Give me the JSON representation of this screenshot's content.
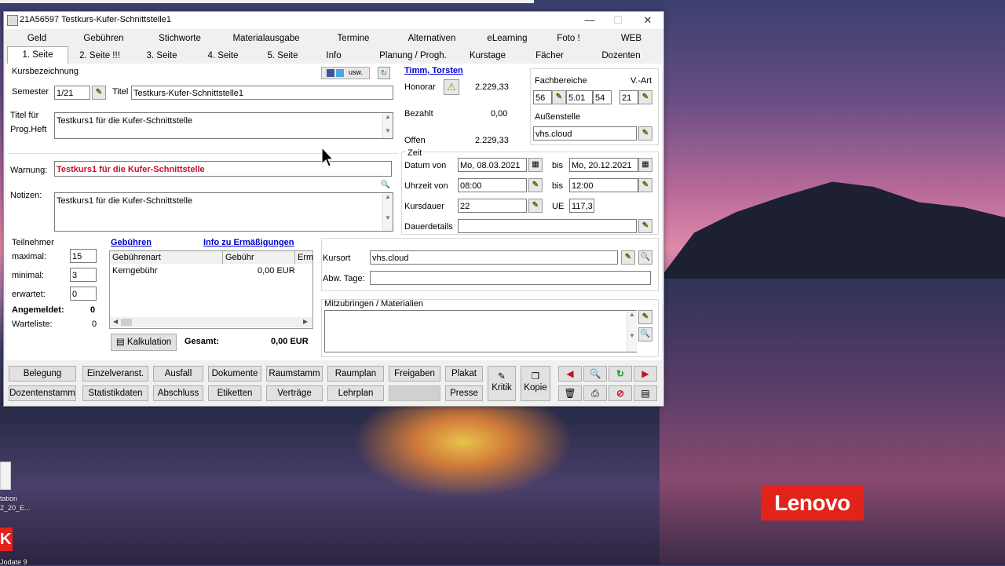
{
  "window": {
    "title": "21A56597 Testkurs-Kufer-Schnittstelle1"
  },
  "tabs_top": [
    "Geld",
    "Gebühren",
    "Stichworte",
    "Materialausgabe",
    "Termine",
    "Alternativen",
    "eLearning",
    "Foto !",
    "WEB"
  ],
  "tabs_bottom": [
    "1. Seite",
    "2. Seite !!!",
    "3. Seite",
    "4. Seite",
    "5. Seite",
    "Info",
    "Planung / Progh.",
    "Kurstage",
    "Fächer",
    "Dozenten"
  ],
  "kurs": {
    "group_label": "Kursbezeichnung",
    "social_label": "usw.",
    "semester_label": "Semester",
    "semester_value": "1/21",
    "titel_label": "Titel",
    "titel_value": "Testkurs-Kufer-Schnittstelle1",
    "titel_prog_label_1": "Titel für",
    "titel_prog_label_2": "Prog.Heft",
    "titel_prog_value": "Testkurs1 für die Kufer-Schnittstelle",
    "warnung_label": "Warnung:",
    "warnung_value": "Testkurs1 für die Kufer-Schnittstelle",
    "notizen_label": "Notizen:",
    "notizen_value": "Testkurs1 für die Kufer-Schnittstelle"
  },
  "finanz": {
    "person": "Timm, Torsten",
    "honorar_label": "Honorar",
    "honorar_value": "2.229,33",
    "bezahlt_label": "Bezahlt",
    "bezahlt_value": "0,00",
    "offen_label": "Offen",
    "offen_value": "2.229,33"
  },
  "fach": {
    "label": "Fachbereiche",
    "vart_label": "V.-Art",
    "f1": "56",
    "f2": "5.01",
    "f3": "54",
    "vart": "21",
    "aussen_label": "Außenstelle",
    "aussen_value": "vhs.cloud"
  },
  "zeit": {
    "label": "Zeit",
    "datum_label": "Datum von",
    "datum_von": "Mo, 08.03.2021",
    "bis_label": "bis",
    "datum_bis": "Mo, 20.12.2021",
    "uhrzeit_label": "Uhrzeit von",
    "uhr_von": "08:00",
    "uhr_bis": "12:00",
    "dauer_label": "Kursdauer",
    "dauer_value": "22",
    "ue_label": "UE",
    "ue_value": "117,3",
    "dauerdetails_label": "Dauerdetails",
    "dauerdetails_value": ""
  },
  "teilnehmer": {
    "label": "Teilnehmer",
    "max_label": "maximal:",
    "max_value": "15",
    "min_label": "minimal:",
    "min_value": "3",
    "erw_label": "erwartet:",
    "erw_value": "0",
    "angemeldet_label": "Angemeldet:",
    "angemeldet_value": "0",
    "warteliste_label": "Warteliste:",
    "warteliste_value": "0"
  },
  "gebuehren": {
    "link": "Gebühren",
    "info_link": "Info zu Ermäßigungen",
    "columns": [
      "Gebührenart",
      "Gebühr",
      "Erm"
    ],
    "rows": [
      {
        "art": "Kerngebühr",
        "gebuehr": "0,00 EUR"
      }
    ],
    "kalkulation_label": "Kalkulation",
    "gesamt_label": "Gesamt:",
    "gesamt_value": "0,00 EUR"
  },
  "ort": {
    "kursort_label": "Kursort",
    "kursort_value": "vhs.cloud",
    "abw_label": "Abw. Tage:",
    "abw_value": "",
    "mitbringen_label": "Mitzubringen / Materialien",
    "mitbringen_value": ""
  },
  "buttons_row1": [
    "Belegung",
    "Einzelveranst.",
    "Ausfall",
    "Dokumente",
    "Raumstamm",
    "Raumplan",
    "Freigaben",
    "Plakat"
  ],
  "buttons_row2": [
    "Dozentenstamm",
    "Statistikdaten",
    "Abschluss",
    "Etiketten",
    "Verträge",
    "Lehrplan",
    "",
    "Presse"
  ],
  "side_buttons": {
    "kritik": "Kritik",
    "kopie": "Kopie"
  },
  "desktop": {
    "brand": "Lenovo",
    "icon_label_1": "tation",
    "icon_label_2": "2_20_E...",
    "icon_label_3": "Jodate 9"
  },
  "colors": {
    "warning_text": "#c8102e",
    "link": "#0000cc",
    "lenovo_red": "#e2231a"
  }
}
